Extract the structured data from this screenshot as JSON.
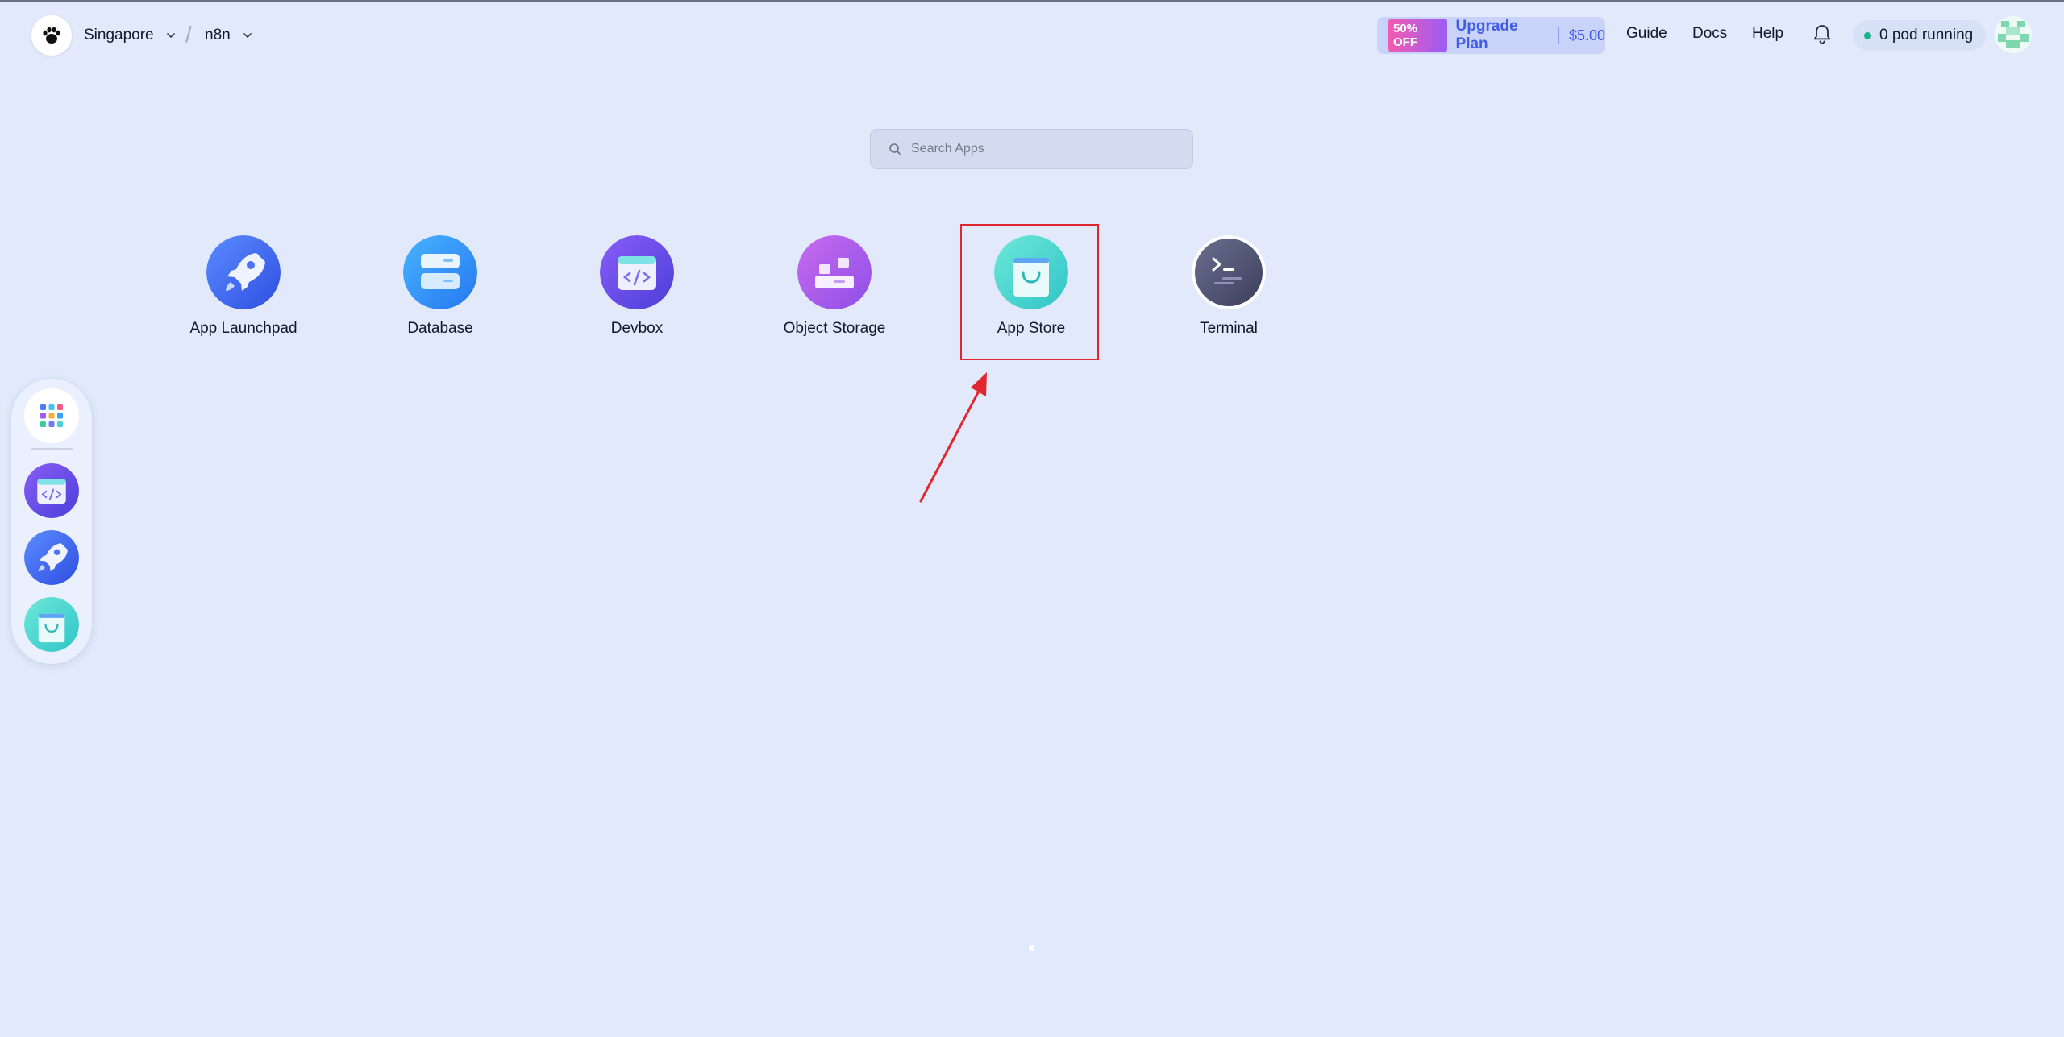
{
  "header": {
    "region": "Singapore",
    "workspace": "n8n",
    "promo": {
      "badge": "50% OFF",
      "label": "Upgrade Plan",
      "price": "$5.00"
    },
    "links": {
      "guide": "Guide",
      "docs": "Docs",
      "help": "Help"
    },
    "pod_status": "0 pod running"
  },
  "search": {
    "placeholder": "Search Apps"
  },
  "apps": [
    {
      "label": "App Launchpad",
      "icon": "rocket-icon"
    },
    {
      "label": "Database",
      "icon": "database-icon"
    },
    {
      "label": "Devbox",
      "icon": "devbox-icon"
    },
    {
      "label": "Object Storage",
      "icon": "object-storage-icon"
    },
    {
      "label": "App Store",
      "icon": "shopping-bag-icon"
    },
    {
      "label": "Terminal",
      "icon": "terminal-icon"
    }
  ],
  "dock": {
    "items": [
      {
        "icon": "app-grid-icon"
      },
      {
        "icon": "devbox-icon"
      },
      {
        "icon": "rocket-icon"
      },
      {
        "icon": "shopping-bag-icon"
      }
    ]
  },
  "colors": {
    "background": "#e1e9fb",
    "accent": "#3f5de6",
    "highlight": "#e0262f",
    "status_running": "#19b58a"
  }
}
